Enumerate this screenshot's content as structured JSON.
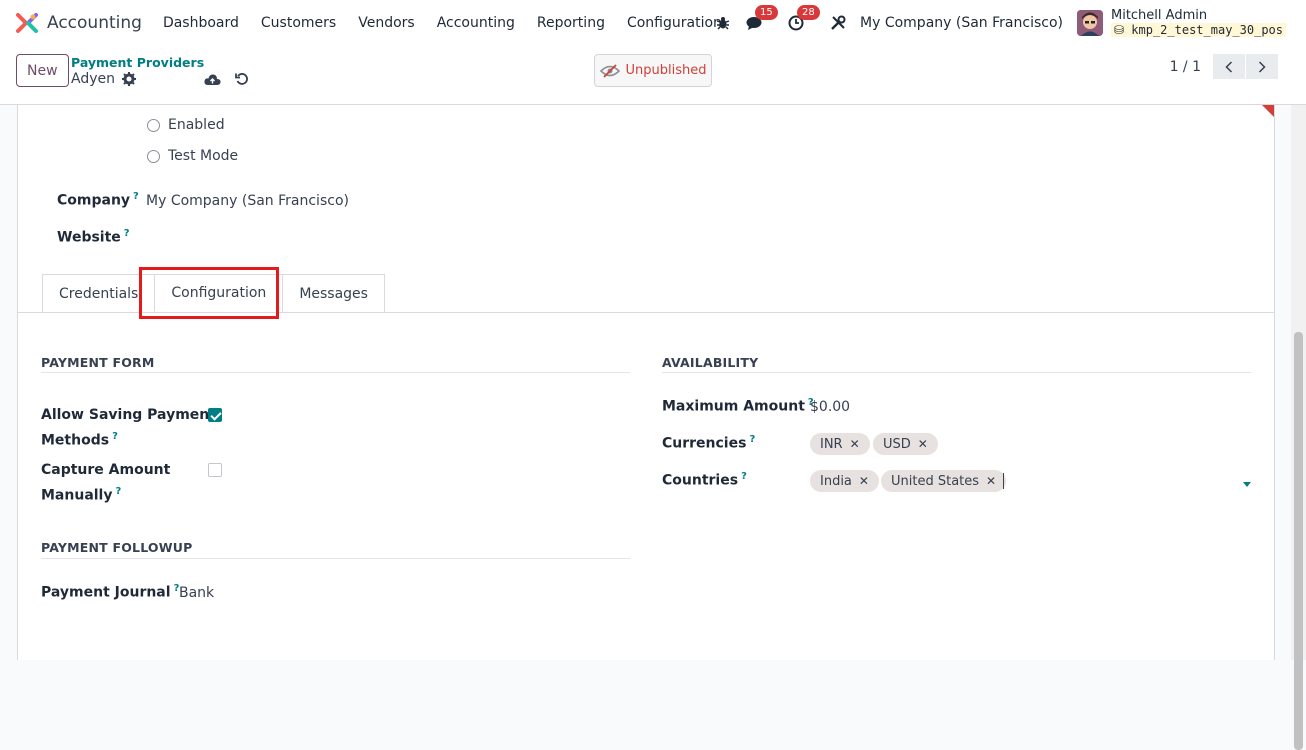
{
  "app": {
    "name": "Accounting"
  },
  "menu": [
    "Dashboard",
    "Customers",
    "Vendors",
    "Accounting",
    "Reporting",
    "Configuration"
  ],
  "systray": {
    "messages_count": "15",
    "activities_count": "28",
    "company": "My Company (San Francisco)",
    "user_name": "Mitchell Admin",
    "db_name": "kmp_2_test_may_30_pos"
  },
  "control": {
    "new_label": "New",
    "breadcrumb_parent": "Payment Providers",
    "breadcrumb_current": "Adyen",
    "unpublished_label": "Unpublished",
    "pager": "1 / 1"
  },
  "form": {
    "state_options": [
      "Enabled",
      "Test Mode"
    ],
    "company_label": "Company",
    "company_value": "My Company (San Francisco)",
    "website_label": "Website",
    "help_mark": "?"
  },
  "tabs": [
    "Credentials",
    "Configuration",
    "Messages"
  ],
  "payment_form": {
    "title": "PAYMENT FORM",
    "allow_saving_label_1": "Allow Saving Payment",
    "allow_saving_label_2": "Methods",
    "allow_saving_checked": true,
    "capture_label_1": "Capture Amount",
    "capture_label_2": "Manually",
    "capture_checked": false
  },
  "payment_followup": {
    "title": "PAYMENT FOLLOWUP",
    "journal_label": "Payment Journal",
    "journal_value": "Bank"
  },
  "availability": {
    "title": "AVAILABILITY",
    "max_amount_label": "Maximum Amount",
    "max_amount_value": "$0.00",
    "currencies_label": "Currencies",
    "currencies": [
      "INR",
      "USD"
    ],
    "countries_label": "Countries",
    "countries": [
      "India",
      "United States"
    ]
  },
  "colors": {
    "brand": "#714b67",
    "accent": "#017e84",
    "danger": "#d23f3a"
  }
}
